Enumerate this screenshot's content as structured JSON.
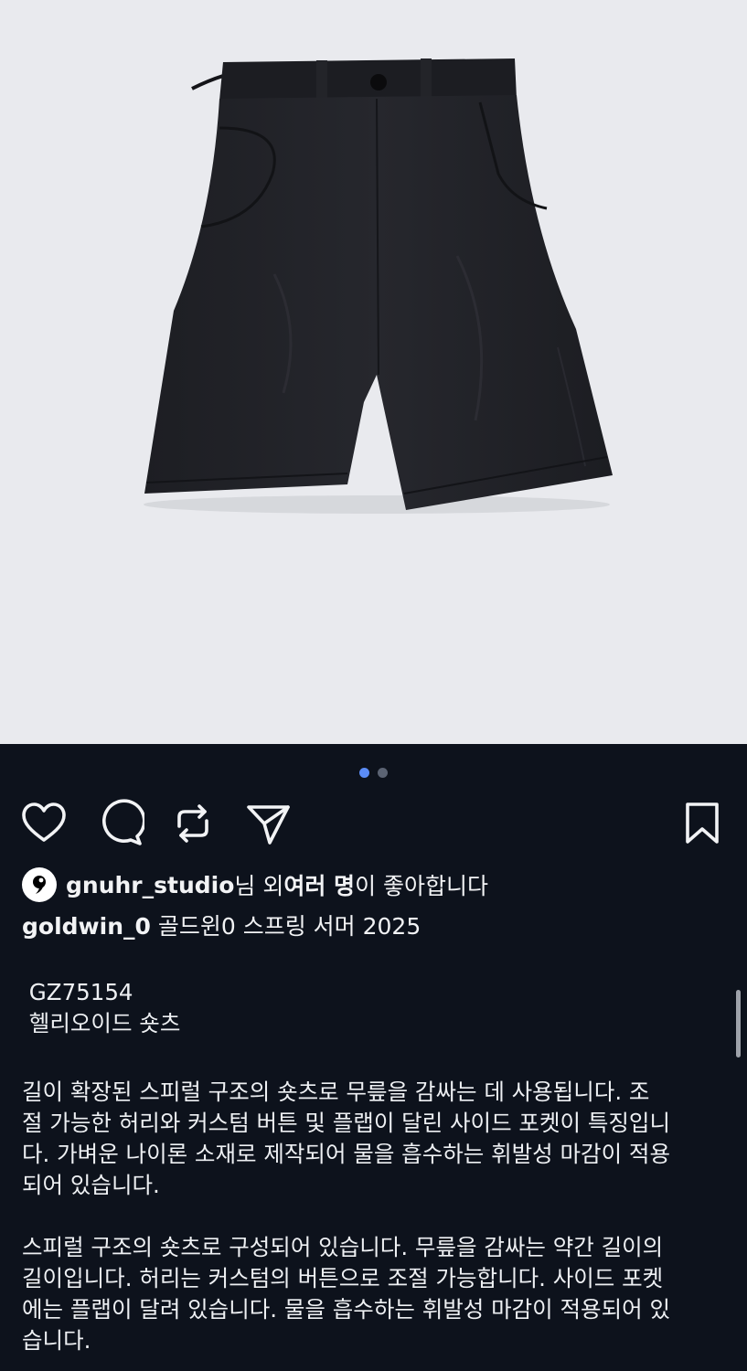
{
  "likes": {
    "user": "gnuhr_studio",
    "suffix_text": "님 외 ",
    "others": "여러 명",
    "liked_text": "이 좋아합니다"
  },
  "caption": {
    "author": "goldwin_0",
    "text": " 골드윈0 스프링 서머 2025"
  },
  "post": {
    "product_code": "GZ75154",
    "product_name": "헬리오이드 숏츠",
    "paragraph1": " 길이 확장된 스피럴 구조의 숏츠로 무릎을 감싸는 데 사용됩니다. 조\n절 가능한 허리와 커스텀 버튼 및 플랩이 달린 사이드 포켓이 특징입니\n다. 가벼운 나이론 소재로 제작되어 물을 흡수하는 휘발성 마감이 적용\n되어 있습니다.",
    "paragraph2": " 스피럴 구조의 숏츠로 구성되어 있습니다. 무릎을 감싸는 약간 길이의\n길이입니다. 허리는 커스텀의 버튼으로 조절 가능합니다. 사이드 포켓\n에는 플랩이 달려 있습니다. 물을 흡수하는 휘발성 마감이 적용되어 있\n습니다."
  },
  "carousel": {
    "total": 2,
    "current": 1
  },
  "icons": {
    "like": "heart-icon",
    "comment": "comment-icon",
    "repost": "repost-icon",
    "share": "send-icon",
    "save": "bookmark-icon"
  },
  "colors": {
    "background": "#0d121c",
    "photo_background": "#e9eaee",
    "active_dot": "#5b8cf6"
  }
}
